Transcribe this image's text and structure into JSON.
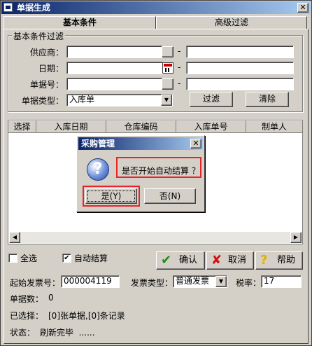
{
  "window": {
    "title": "单据生成",
    "close_glyph": "✕"
  },
  "tabs": [
    {
      "label": "基本条件",
      "active": true
    },
    {
      "label": "高级过滤",
      "active": false
    }
  ],
  "filter_group": {
    "title": "基本条件过滤",
    "supplier_label": "供应商：",
    "supplier_from": "",
    "supplier_to": "",
    "date_label": "日期：",
    "date_from": "",
    "date_to": "",
    "doc_no_label": "单据号：",
    "doc_no_from": "",
    "doc_no_to": "",
    "doc_type_label": "单据类型：",
    "doc_type_value": "入库单",
    "range_dash": "-",
    "filter_button": "过滤",
    "clear_button": "清除"
  },
  "grid": {
    "columns": [
      "选择",
      "入库日期",
      "仓库编码",
      "入库单号",
      "制单人"
    ],
    "rows": []
  },
  "options": {
    "select_all_label": "全选",
    "select_all_checked": false,
    "auto_settle_label": "自动结算",
    "auto_settle_checked": true,
    "check_glyph": "✔"
  },
  "actions": {
    "confirm_label": "确认",
    "cancel_label": "取消",
    "help_label": "帮助",
    "confirm_icon": "✔",
    "cancel_icon": "✘",
    "help_icon": "?"
  },
  "invoice": {
    "start_no_label": "起始发票号：",
    "start_no_value": "000004119",
    "type_label": "发票类型：",
    "type_value": "普通发票",
    "tax_label": "税率：",
    "tax_value": "17"
  },
  "status": {
    "doc_count_label": "单据数：",
    "doc_count_value": "0",
    "selected_label": "已选择：",
    "selected_value": "[0]张单据,[0]条记录",
    "state_label": "状态：",
    "state_value": "刷新完毕  ......"
  },
  "dialog": {
    "title": "采购管理",
    "message": "是否开始自动结算 ？",
    "yes_button": "是(Y)",
    "no_button": "否(N)",
    "icon_glyph": "?"
  },
  "colors": {
    "title_bar": "#0a246a",
    "highlight": "#e8242a",
    "confirm_icon": "#1a8f1a",
    "cancel_icon": "#d01010",
    "help_icon": "#e0b000"
  }
}
